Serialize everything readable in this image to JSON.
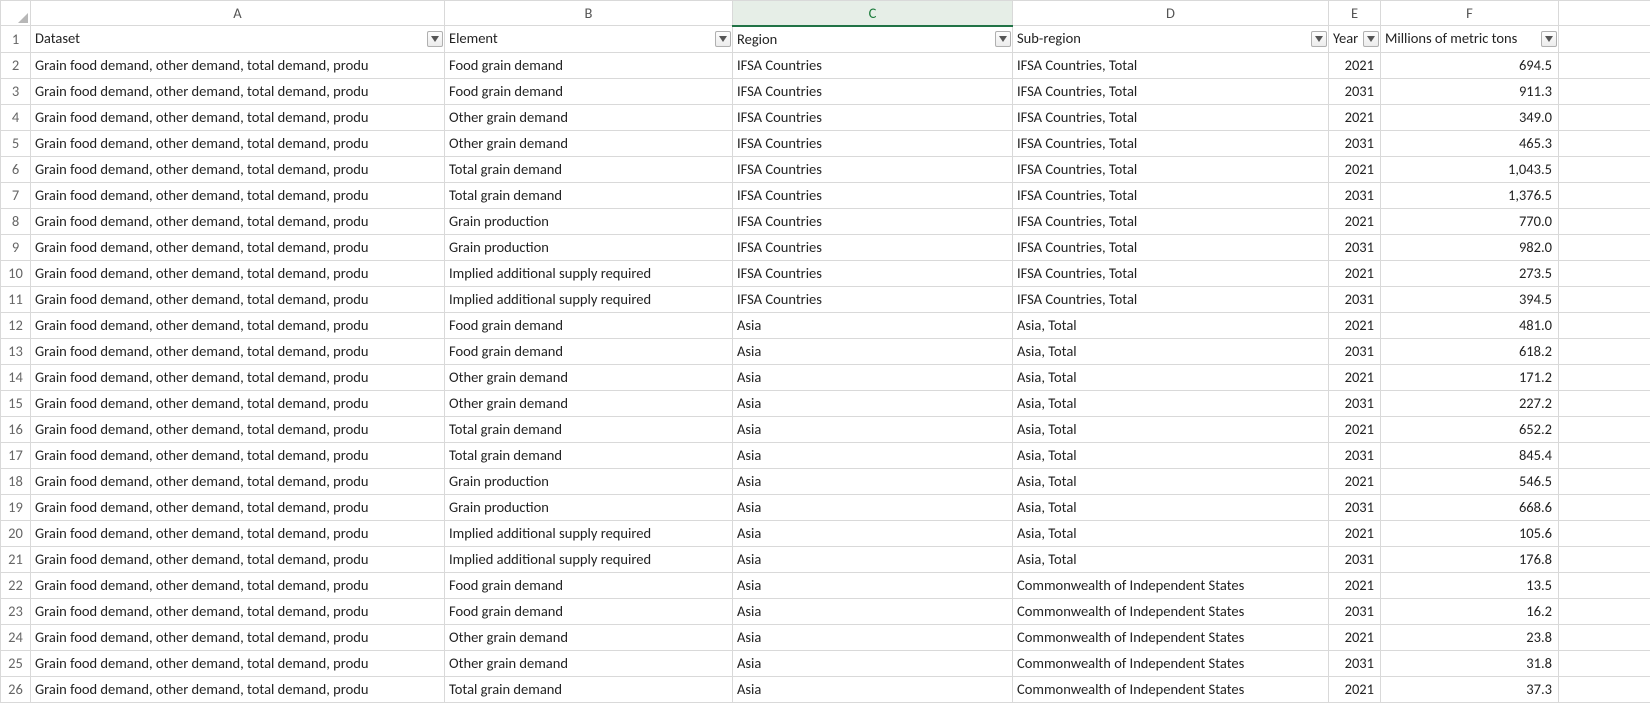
{
  "columns": {
    "letters": [
      "A",
      "B",
      "C",
      "D",
      "E",
      "F"
    ],
    "selected": "C",
    "headers": {
      "A": "Dataset",
      "B": "Element",
      "C": "Region",
      "D": "Sub-region",
      "E": "Year",
      "F": "Millions of metric tons"
    }
  },
  "dataset_text": "Grain food demand, other demand, total demand, produ",
  "rows": [
    {
      "n": 2,
      "element": "Food grain demand",
      "region": "IFSA Countries",
      "sub": "IFSA Countries, Total",
      "year": "2021",
      "val": "694.5"
    },
    {
      "n": 3,
      "element": "Food grain demand",
      "region": "IFSA Countries",
      "sub": "IFSA Countries, Total",
      "year": "2031",
      "val": "911.3"
    },
    {
      "n": 4,
      "element": "Other grain demand",
      "region": "IFSA Countries",
      "sub": "IFSA Countries, Total",
      "year": "2021",
      "val": "349.0"
    },
    {
      "n": 5,
      "element": "Other grain demand",
      "region": "IFSA Countries",
      "sub": "IFSA Countries, Total",
      "year": "2031",
      "val": "465.3"
    },
    {
      "n": 6,
      "element": "Total grain demand",
      "region": "IFSA Countries",
      "sub": "IFSA Countries, Total",
      "year": "2021",
      "val": "1,043.5"
    },
    {
      "n": 7,
      "element": "Total grain demand",
      "region": "IFSA Countries",
      "sub": "IFSA Countries, Total",
      "year": "2031",
      "val": "1,376.5"
    },
    {
      "n": 8,
      "element": "Grain production",
      "region": "IFSA Countries",
      "sub": "IFSA Countries, Total",
      "year": "2021",
      "val": "770.0"
    },
    {
      "n": 9,
      "element": "Grain production",
      "region": "IFSA Countries",
      "sub": "IFSA Countries, Total",
      "year": "2031",
      "val": "982.0"
    },
    {
      "n": 10,
      "element": "Implied additional supply required",
      "region": "IFSA Countries",
      "sub": "IFSA Countries, Total",
      "year": "2021",
      "val": "273.5"
    },
    {
      "n": 11,
      "element": "Implied additional supply required",
      "region": "IFSA Countries",
      "sub": "IFSA Countries, Total",
      "year": "2031",
      "val": "394.5"
    },
    {
      "n": 12,
      "element": "Food grain demand",
      "region": "Asia",
      "sub": "Asia, Total",
      "year": "2021",
      "val": "481.0"
    },
    {
      "n": 13,
      "element": "Food grain demand",
      "region": "Asia",
      "sub": "Asia, Total",
      "year": "2031",
      "val": "618.2"
    },
    {
      "n": 14,
      "element": "Other grain demand",
      "region": "Asia",
      "sub": "Asia, Total",
      "year": "2021",
      "val": "171.2"
    },
    {
      "n": 15,
      "element": "Other grain demand",
      "region": "Asia",
      "sub": "Asia, Total",
      "year": "2031",
      "val": "227.2"
    },
    {
      "n": 16,
      "element": "Total grain demand",
      "region": "Asia",
      "sub": "Asia, Total",
      "year": "2021",
      "val": "652.2"
    },
    {
      "n": 17,
      "element": "Total grain demand",
      "region": "Asia",
      "sub": "Asia, Total",
      "year": "2031",
      "val": "845.4"
    },
    {
      "n": 18,
      "element": "Grain production",
      "region": "Asia",
      "sub": "Asia, Total",
      "year": "2021",
      "val": "546.5"
    },
    {
      "n": 19,
      "element": "Grain production",
      "region": "Asia",
      "sub": "Asia, Total",
      "year": "2031",
      "val": "668.6"
    },
    {
      "n": 20,
      "element": "Implied additional supply required",
      "region": "Asia",
      "sub": "Asia, Total",
      "year": "2021",
      "val": "105.6"
    },
    {
      "n": 21,
      "element": "Implied additional supply required",
      "region": "Asia",
      "sub": "Asia, Total",
      "year": "2031",
      "val": "176.8"
    },
    {
      "n": 22,
      "element": "Food grain demand",
      "region": "Asia",
      "sub": "Commonwealth of Independent States",
      "year": "2021",
      "val": "13.5"
    },
    {
      "n": 23,
      "element": "Food grain demand",
      "region": "Asia",
      "sub": "Commonwealth of Independent States",
      "year": "2031",
      "val": "16.2"
    },
    {
      "n": 24,
      "element": "Other grain demand",
      "region": "Asia",
      "sub": "Commonwealth of Independent States",
      "year": "2021",
      "val": "23.8"
    },
    {
      "n": 25,
      "element": "Other grain demand",
      "region": "Asia",
      "sub": "Commonwealth of Independent States",
      "year": "2031",
      "val": "31.8"
    },
    {
      "n": 26,
      "element": "Total grain demand",
      "region": "Asia",
      "sub": "Commonwealth of Independent States",
      "year": "2021",
      "val": "37.3"
    }
  ]
}
